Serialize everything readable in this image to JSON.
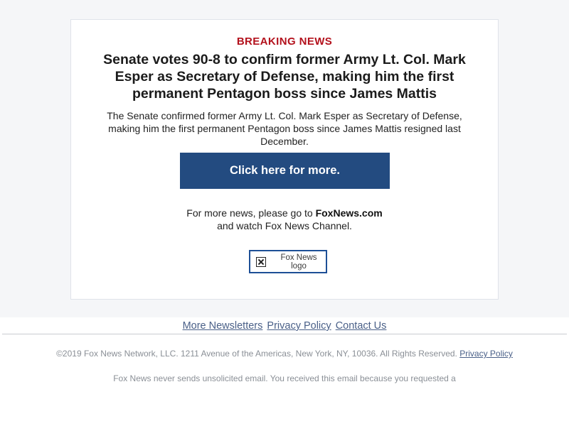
{
  "colors": {
    "breaking_red": "#b3111c",
    "cta_blue": "#234b80",
    "band_bg": "#f5f6f8",
    "link_blue": "#4a6088"
  },
  "alert": {
    "kicker": "BREAKING NEWS",
    "headline": "Senate votes 90-8 to confirm former Army Lt. Col. Mark Esper as Secretary of Defense, making him the first permanent Pentagon boss since James Mattis",
    "summary": "The Senate confirmed former Army Lt. Col. Mark Esper as Secretary of Defense, making him the first permanent Pentagon boss since James Mattis resigned last December.",
    "cta_label": "Click here for more.",
    "more_news_prefix": "For more news, please go to ",
    "more_news_site": "FoxNews.com",
    "more_news_suffix": "and watch Fox News Channel.",
    "logo_alt": "Fox News logo",
    "logo_icon": "broken-image-icon"
  },
  "footer": {
    "links": [
      "More Newsletters",
      "Privacy Policy",
      "Contact Us"
    ],
    "copyright_text": "©2019 Fox News Network, LLC. 1211 Avenue of the Americas, New York, NY, 10036. All Rights Reserved.",
    "copyright_link": "Privacy Policy",
    "disclaimer": "Fox News never sends unsolicited email. You received this email because you requested a"
  }
}
